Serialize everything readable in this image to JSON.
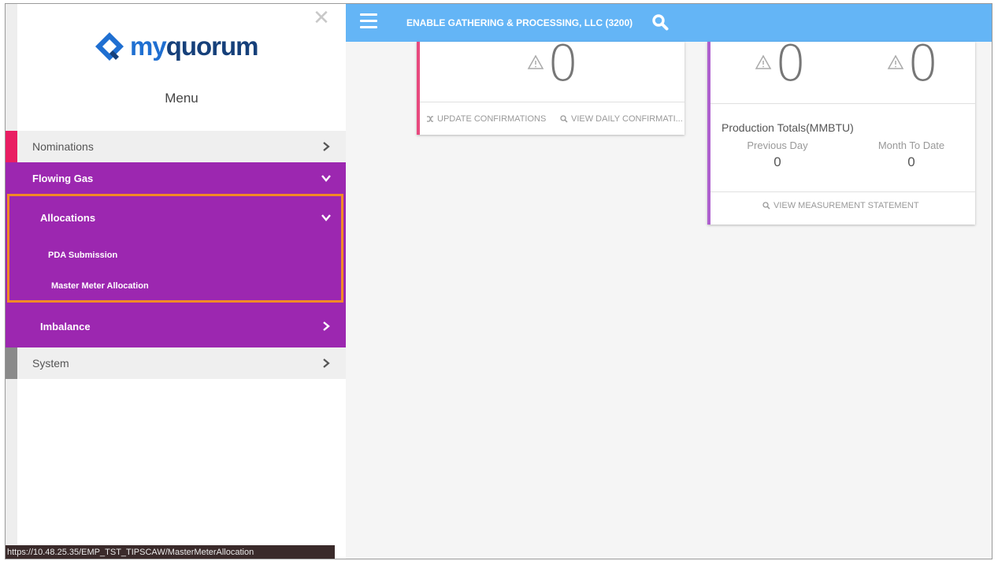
{
  "sidebar": {
    "logo": {
      "my": "my",
      "quorum": "quorum"
    },
    "menu_title": "Menu",
    "items": {
      "nominations": "Nominations",
      "flowing_gas": "Flowing Gas",
      "allocations": "Allocations",
      "pda_submission": "PDA Submission",
      "master_meter_allocation": "Master Meter Allocation",
      "imbalance": "Imbalance",
      "system": "System"
    },
    "status_url": "https://10.48.25.35/EMP_TST_TIPSCAW/MasterMeterAllocation"
  },
  "header": {
    "company": "ENABLE GATHERING & PROCESSING, LLC (3200)"
  },
  "cards": {
    "left": {
      "count": "0",
      "actions": [
        "UPDATE CONFIRMATIONS",
        "VIEW DAILY CONFIRMATI..."
      ]
    },
    "right": {
      "count_a": "0",
      "count_b": "0",
      "production_title": "Production Totals(MMBTU)",
      "previous_day_label": "Previous Day",
      "previous_day_value": "0",
      "month_to_date_label": "Month To Date",
      "month_to_date_value": "0",
      "action": "VIEW MEASUREMENT STATEMENT"
    }
  },
  "colors": {
    "header_blue": "#64b5f6",
    "purple": "#9c27b0",
    "nominations_accent": "#e91e63",
    "highlight_orange": "#f28a25"
  }
}
